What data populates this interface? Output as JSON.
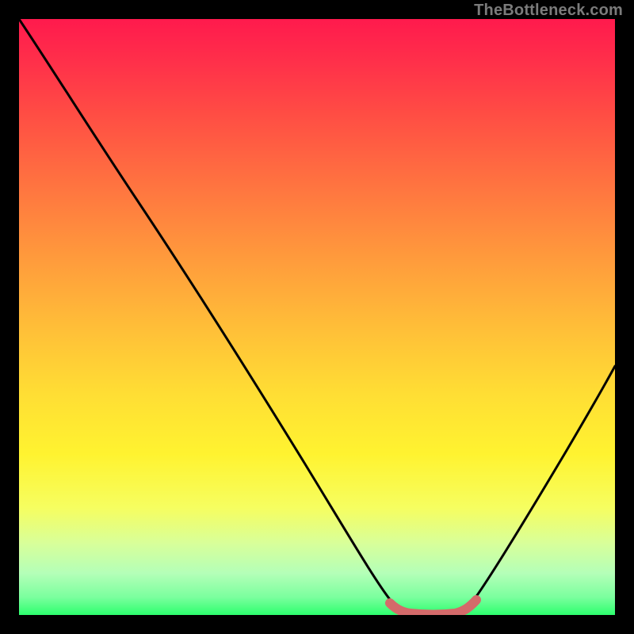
{
  "watermark": "TheBottleneck.com",
  "chart_data": {
    "type": "line",
    "title": "",
    "xlabel": "",
    "ylabel": "",
    "xlim": [
      0,
      100
    ],
    "ylim": [
      0,
      100
    ],
    "x": [
      0,
      5,
      10,
      15,
      20,
      25,
      30,
      35,
      40,
      45,
      50,
      55,
      60,
      62,
      64,
      66,
      68,
      70,
      72,
      74,
      76,
      80,
      85,
      90,
      95,
      100
    ],
    "values": [
      100,
      92,
      85,
      77,
      70,
      62,
      54,
      46,
      38,
      30,
      22,
      14,
      6,
      3,
      1.5,
      1,
      1,
      1,
      1.5,
      3,
      6,
      12,
      20,
      28,
      36,
      44
    ],
    "series": [
      {
        "name": "bottleneck-curve",
        "color": "#000000"
      },
      {
        "name": "sweet-spot-marker",
        "color": "#d46a6a",
        "x": [
          62,
          74
        ],
        "values": [
          1.2,
          1.2
        ]
      }
    ],
    "gradient_stops": [
      {
        "pos": 0.0,
        "color": "#ff1a4d"
      },
      {
        "pos": 0.52,
        "color": "#ffbf38"
      },
      {
        "pos": 0.73,
        "color": "#fff330"
      },
      {
        "pos": 1.0,
        "color": "#2dff6e"
      }
    ]
  }
}
